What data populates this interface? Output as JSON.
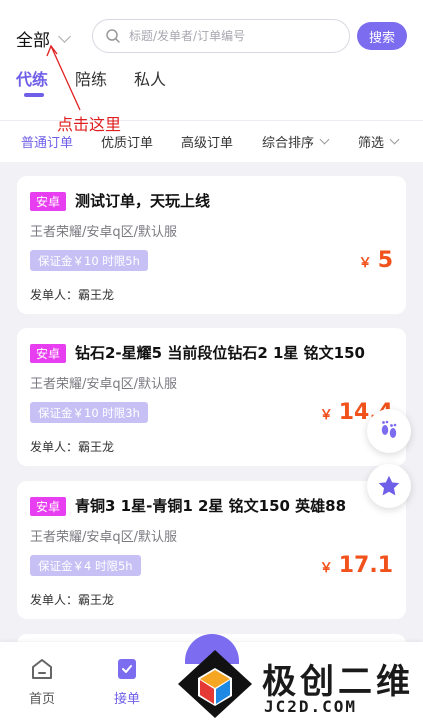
{
  "header": {
    "region_label": "全部",
    "search_placeholder": "标题/发单者/订单编号",
    "search_button": "搜索"
  },
  "tabs": [
    {
      "label": "代练",
      "active": true
    },
    {
      "label": "陪练",
      "active": false
    },
    {
      "label": "私人",
      "active": false
    }
  ],
  "annotation": {
    "text": "点击这里"
  },
  "filters": [
    {
      "label": "普通订单",
      "active": true
    },
    {
      "label": "优质订单",
      "active": false
    },
    {
      "label": "高级订单",
      "active": false
    },
    {
      "label": "综合排序",
      "active": false
    },
    {
      "label": "筛选",
      "active": false
    }
  ],
  "orders": [
    {
      "badge": "安卓",
      "title": "测试订单，天玩上线",
      "game": "王者荣耀/安卓q区/默认服",
      "deposit": "保证金￥10 时限5h",
      "currency": "￥",
      "price": "5",
      "issuer": "发单人：霸王龙"
    },
    {
      "badge": "安卓",
      "title": "钻石2-星耀5 当前段位钻石2 1星 铭文150",
      "game": "王者荣耀/安卓q区/默认服",
      "deposit": "保证金￥10 时限3h",
      "currency": "￥",
      "price": "14.4",
      "issuer": "发单人：霸王龙"
    },
    {
      "badge": "安卓",
      "title": "青铜3 1星-青铜1 2星 铭文150 英雄88",
      "game": "王者荣耀/安卓q区/默认服",
      "deposit": "保证金￥4 时限5h",
      "currency": "￥",
      "price": "17.1",
      "issuer": "发单人：霸王龙"
    }
  ],
  "bottom_nav": [
    {
      "label": "首页",
      "icon": "home-icon",
      "active": false
    },
    {
      "label": "接单",
      "icon": "order-icon",
      "active": true
    }
  ],
  "watermark": {
    "text": "极创二维",
    "sub": "JC2D.COM"
  },
  "colors": {
    "accent": "#6f5fe8",
    "price": "#f1511b",
    "badge": "#e83ef2",
    "deposit": "#c7c0f5",
    "annotation": "#e02020"
  }
}
